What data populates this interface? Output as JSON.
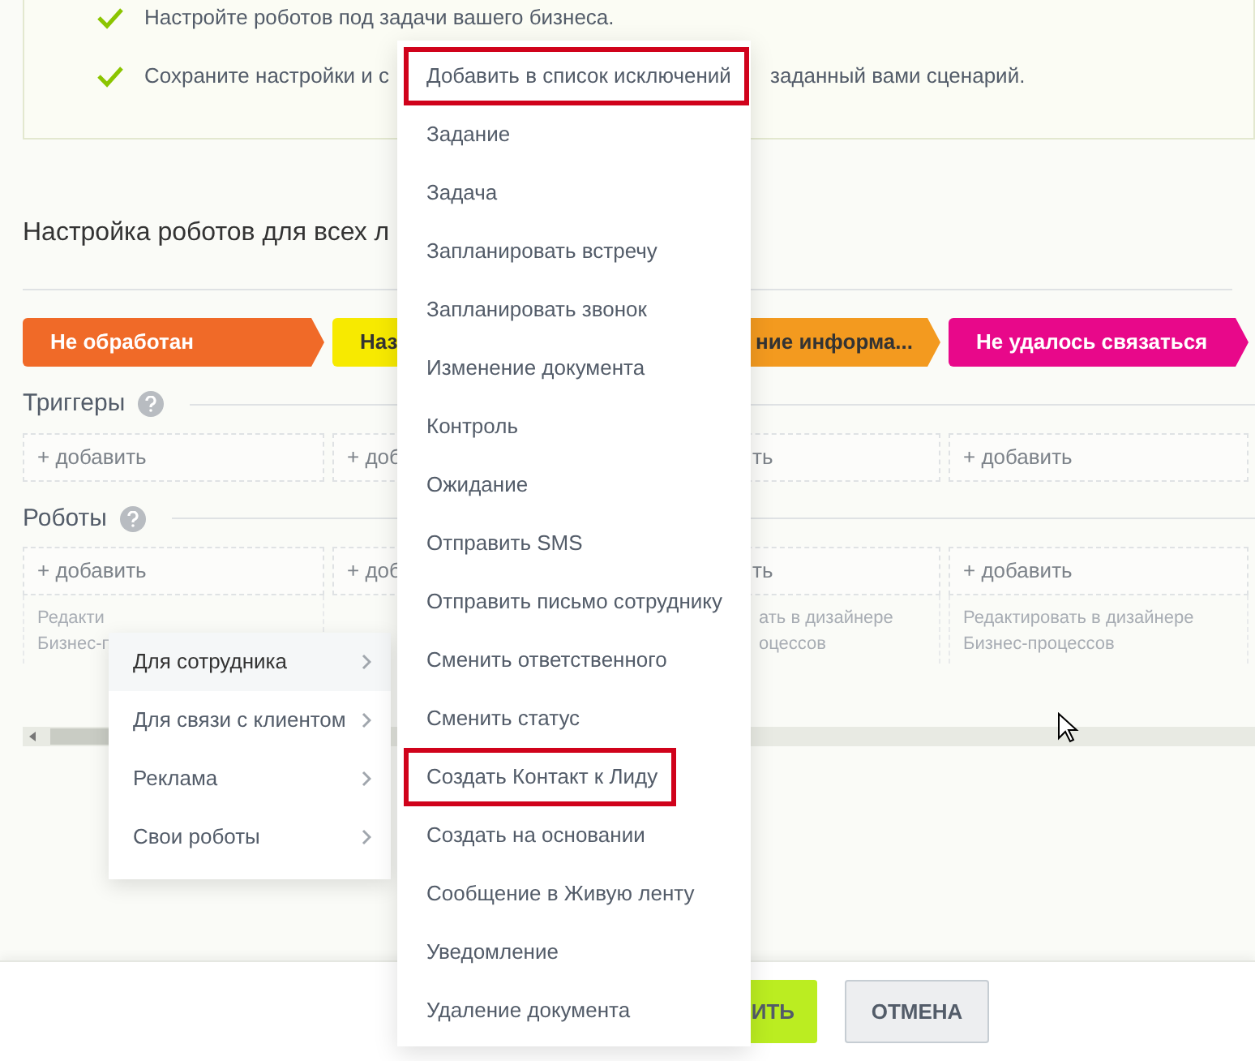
{
  "intro": {
    "items": [
      {
        "parts": [
          "Настройте роботов под задачи вашего бизнеса."
        ]
      },
      {
        "parts": [
          "Сохраните настройки и с",
          "заданный вами сценарий."
        ]
      }
    ]
  },
  "heading": "Настройка роботов для всех л",
  "stages": [
    {
      "label": "Не обработан",
      "color": "#f06a28"
    },
    {
      "label": "Наз",
      "color": "#f7ea00"
    },
    {
      "label": "ние информа...",
      "color": "#f39a1f"
    },
    {
      "label": "Не удалось связаться",
      "color": "#e8088a"
    }
  ],
  "sections": [
    {
      "title": "Триггеры",
      "cells": [
        {
          "add": "+ добавить"
        },
        {
          "add": "+ доб"
        },
        {
          "add": "ть"
        },
        {
          "add": "+ добавить"
        }
      ]
    },
    {
      "title": "Роботы",
      "cells": [
        {
          "add": "+ добавить",
          "note": [
            "Редакти",
            "Бизнес-п"
          ]
        },
        {
          "add": "+ доб"
        },
        {
          "add": "ть",
          "note": [
            "ать в дизайнере",
            "оцессов"
          ]
        },
        {
          "add": "+ добавить",
          "note": [
            "Редактировать в дизайнере",
            "Бизнес-процессов"
          ]
        }
      ]
    }
  ],
  "buttons": [
    {
      "label": "ИТЬ",
      "kind": "primary"
    },
    {
      "label": "ОТМЕНА",
      "kind": "secondary"
    }
  ],
  "submenu": [
    {
      "label": "Для сотрудника",
      "selected": true
    },
    {
      "label": "Для связи с клиентом",
      "selected": false
    },
    {
      "label": "Реклама",
      "selected": false
    },
    {
      "label": "Свои роботы",
      "selected": false
    }
  ],
  "menu": [
    {
      "label": "Добавить в список исключений",
      "highlighted": true
    },
    {
      "label": "Задание",
      "highlighted": false
    },
    {
      "label": "Задача",
      "highlighted": false
    },
    {
      "label": "Запланировать встречу",
      "highlighted": false
    },
    {
      "label": "Запланировать звонок",
      "highlighted": false
    },
    {
      "label": "Изменение документа",
      "highlighted": false
    },
    {
      "label": "Контроль",
      "highlighted": false
    },
    {
      "label": "Ожидание",
      "highlighted": false
    },
    {
      "label": "Отправить SMS",
      "highlighted": false
    },
    {
      "label": "Отправить письмо сотруднику",
      "highlighted": false
    },
    {
      "label": "Сменить ответственного",
      "highlighted": false
    },
    {
      "label": "Сменить статус",
      "highlighted": false
    },
    {
      "label": "Создать Контакт к Лиду",
      "highlighted": true
    },
    {
      "label": "Создать на основании",
      "highlighted": false
    },
    {
      "label": "Сообщение в Живую ленту",
      "highlighted": false
    },
    {
      "label": "Уведомление",
      "highlighted": false
    },
    {
      "label": "Удаление документа",
      "highlighted": false
    }
  ]
}
